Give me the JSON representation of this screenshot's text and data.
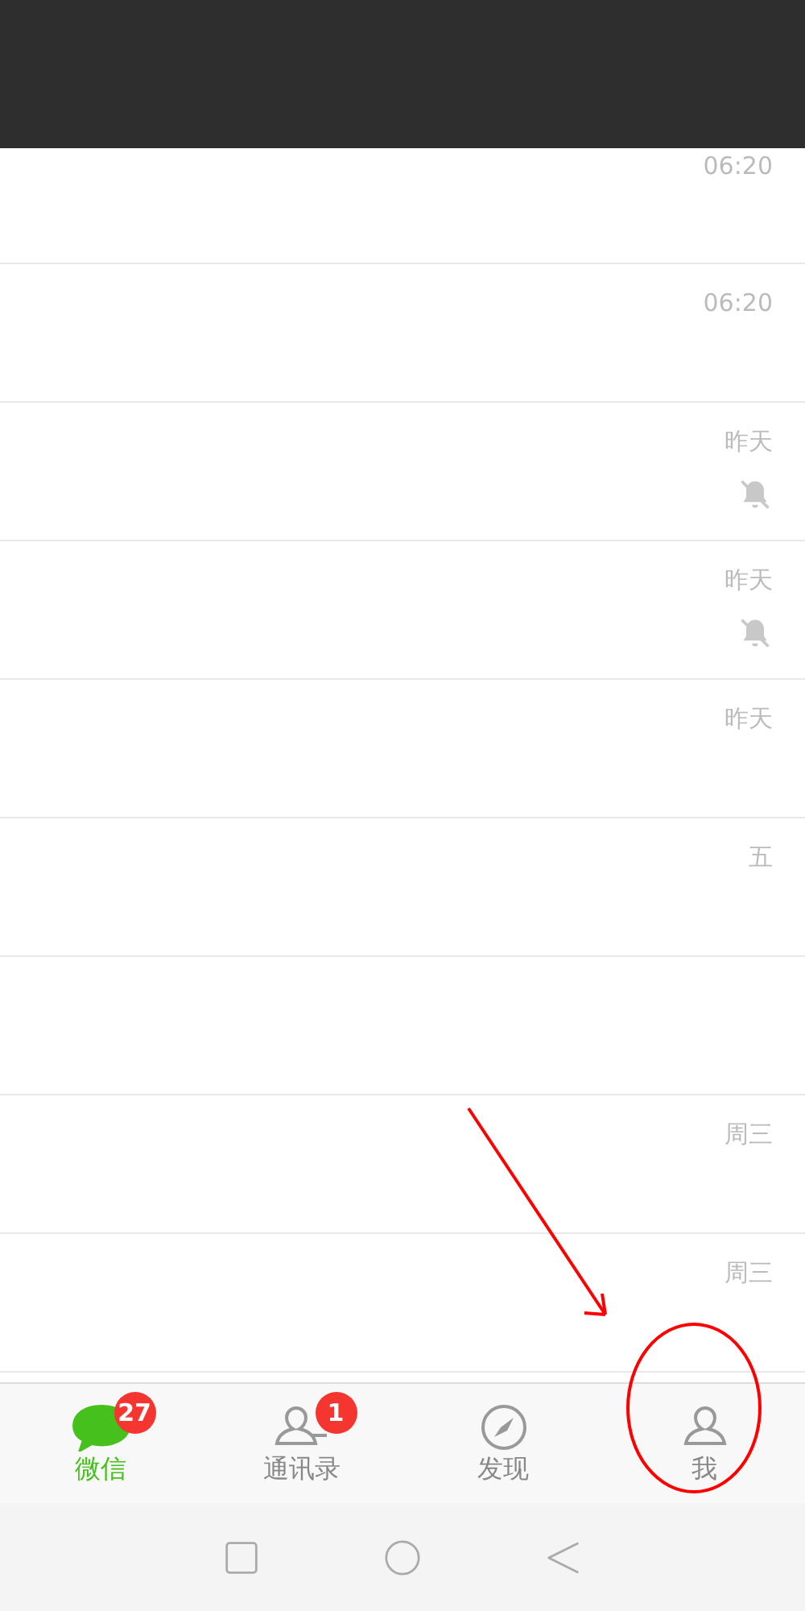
{
  "chats": [
    {
      "time": "06:20",
      "muted": false
    },
    {
      "time": "06:20",
      "muted": false
    },
    {
      "time": "昨天",
      "muted": true
    },
    {
      "time": "昨天",
      "muted": true
    },
    {
      "time": "昨天",
      "muted": false
    },
    {
      "time": "五",
      "muted": false
    },
    {
      "muted": false
    },
    {
      "time": "周三",
      "muted": false
    },
    {
      "time": "周三",
      "muted": false
    }
  ],
  "tabs": [
    {
      "label": "微信",
      "kind": "chat",
      "badge": "27",
      "selected": true
    },
    {
      "label": "通讯录",
      "kind": "contacts",
      "badge": "1",
      "selected": false
    },
    {
      "label": "发现",
      "kind": "discover",
      "selected": false
    },
    {
      "label": "我",
      "kind": "me",
      "selected": false
    }
  ]
}
